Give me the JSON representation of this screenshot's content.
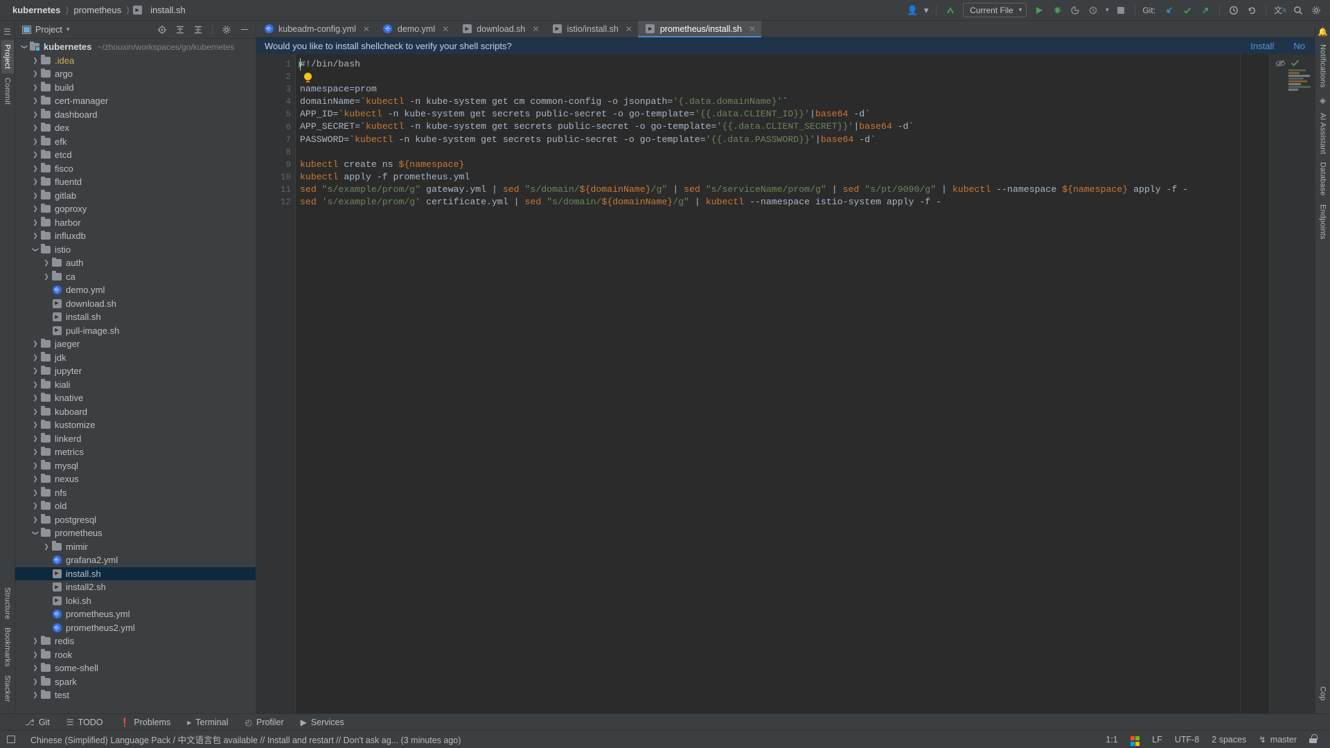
{
  "breadcrumb": {
    "segments": [
      "kubernetes",
      "prometheus",
      "install.sh"
    ],
    "separator": "〉"
  },
  "toolbar_right": {
    "user_icon": "person-icon",
    "updates_icon": "update-arrow-icon",
    "run_config": "Current File",
    "run_icon": "run-icon",
    "debug_icon": "debug-icon",
    "coverage_icon": "coverage-icon",
    "profile_icon": "profile-icon",
    "stop_icon": "stop-icon",
    "git_label": "Git:",
    "git_update_icon": "update-project-icon",
    "git_commit_icon": "commit-icon",
    "git_push_icon": "push-icon",
    "history_icon": "history-icon",
    "rollback_icon": "rollback-icon",
    "translate_icon": "translate-icon",
    "search_icon": "search-icon",
    "settings_icon": "gear-icon",
    "more_icon": "more-vertical-icon"
  },
  "left_rail": {
    "project_label": "Project",
    "commit_label": "Commit",
    "structure_label": "Structure",
    "bookmarks_label": "Bookmarks",
    "stacker_label": "Stacker"
  },
  "right_rail": {
    "notifications_label": "Notifications",
    "ai_assistant_label": "AI Assistant",
    "database_label": "Database",
    "endpoints_label": "Endpoints",
    "cop_label": "Cop"
  },
  "project_panel": {
    "title": "Project",
    "chevron": "▾",
    "icons": [
      "locate-icon",
      "expand-all-icon",
      "collapse-all-icon",
      "gear-icon",
      "minimize-icon"
    ],
    "root": {
      "label": "kubernetes",
      "path": "~/zhouxin/workspaces/go/kubernetes"
    },
    "tree": [
      {
        "label": "kubernetes",
        "type": "root",
        "depth": 0,
        "expanded": true,
        "path": "~/zhouxin/workspaces/go/kubernetes"
      },
      {
        "label": ".idea",
        "type": "folder",
        "depth": 1,
        "expanded": false,
        "color": "yellow"
      },
      {
        "label": "argo",
        "type": "folder",
        "depth": 1,
        "expanded": false
      },
      {
        "label": "build",
        "type": "folder",
        "depth": 1,
        "expanded": false
      },
      {
        "label": "cert-manager",
        "type": "folder",
        "depth": 1,
        "expanded": false
      },
      {
        "label": "dashboard",
        "type": "folder",
        "depth": 1,
        "expanded": false
      },
      {
        "label": "dex",
        "type": "folder",
        "depth": 1,
        "expanded": false
      },
      {
        "label": "efk",
        "type": "folder",
        "depth": 1,
        "expanded": false
      },
      {
        "label": "etcd",
        "type": "folder",
        "depth": 1,
        "expanded": false
      },
      {
        "label": "fisco",
        "type": "folder",
        "depth": 1,
        "expanded": false
      },
      {
        "label": "fluentd",
        "type": "folder",
        "depth": 1,
        "expanded": false
      },
      {
        "label": "gitlab",
        "type": "folder",
        "depth": 1,
        "expanded": false
      },
      {
        "label": "goproxy",
        "type": "folder",
        "depth": 1,
        "expanded": false
      },
      {
        "label": "harbor",
        "type": "folder",
        "depth": 1,
        "expanded": false
      },
      {
        "label": "influxdb",
        "type": "folder",
        "depth": 1,
        "expanded": false
      },
      {
        "label": "istio",
        "type": "folder",
        "depth": 1,
        "expanded": true
      },
      {
        "label": "auth",
        "type": "folder",
        "depth": 2,
        "expanded": false
      },
      {
        "label": "ca",
        "type": "folder",
        "depth": 2,
        "expanded": false
      },
      {
        "label": "demo.yml",
        "type": "yml",
        "depth": 2
      },
      {
        "label": "download.sh",
        "type": "sh",
        "depth": 2
      },
      {
        "label": "install.sh",
        "type": "sh",
        "depth": 2
      },
      {
        "label": "pull-image.sh",
        "type": "sh",
        "depth": 2
      },
      {
        "label": "jaeger",
        "type": "folder",
        "depth": 1,
        "expanded": false
      },
      {
        "label": "jdk",
        "type": "folder",
        "depth": 1,
        "expanded": false
      },
      {
        "label": "jupyter",
        "type": "folder",
        "depth": 1,
        "expanded": false
      },
      {
        "label": "kiali",
        "type": "folder",
        "depth": 1,
        "expanded": false
      },
      {
        "label": "knative",
        "type": "folder",
        "depth": 1,
        "expanded": false
      },
      {
        "label": "kuboard",
        "type": "folder",
        "depth": 1,
        "expanded": false
      },
      {
        "label": "kustomize",
        "type": "folder",
        "depth": 1,
        "expanded": false
      },
      {
        "label": "linkerd",
        "type": "folder",
        "depth": 1,
        "expanded": false
      },
      {
        "label": "metrics",
        "type": "folder",
        "depth": 1,
        "expanded": false
      },
      {
        "label": "mysql",
        "type": "folder",
        "depth": 1,
        "expanded": false
      },
      {
        "label": "nexus",
        "type": "folder",
        "depth": 1,
        "expanded": false
      },
      {
        "label": "nfs",
        "type": "folder",
        "depth": 1,
        "expanded": false
      },
      {
        "label": "old",
        "type": "folder",
        "depth": 1,
        "expanded": false
      },
      {
        "label": "postgresql",
        "type": "folder",
        "depth": 1,
        "expanded": false
      },
      {
        "label": "prometheus",
        "type": "folder",
        "depth": 1,
        "expanded": true
      },
      {
        "label": "mimir",
        "type": "folder",
        "depth": 2,
        "expanded": false
      },
      {
        "label": "grafana2.yml",
        "type": "yml",
        "depth": 2
      },
      {
        "label": "install.sh",
        "type": "sh",
        "depth": 2,
        "selected": true
      },
      {
        "label": "install2.sh",
        "type": "sh",
        "depth": 2
      },
      {
        "label": "loki.sh",
        "type": "sh",
        "depth": 2
      },
      {
        "label": "prometheus.yml",
        "type": "yml",
        "depth": 2
      },
      {
        "label": "prometheus2.yml",
        "type": "yml",
        "depth": 2
      },
      {
        "label": "redis",
        "type": "folder",
        "depth": 1,
        "expanded": false
      },
      {
        "label": "rook",
        "type": "folder",
        "depth": 1,
        "expanded": false
      },
      {
        "label": "some-shell",
        "type": "folder",
        "depth": 1,
        "expanded": false
      },
      {
        "label": "spark",
        "type": "folder",
        "depth": 1,
        "expanded": false
      },
      {
        "label": "test",
        "type": "folder",
        "depth": 1,
        "expanded": false
      }
    ]
  },
  "editor_tabs": [
    {
      "label": "kubeadm-config.yml",
      "icon": "k8s-yml-icon",
      "active": false,
      "closable": true
    },
    {
      "label": "demo.yml",
      "icon": "k8s-yml-icon",
      "active": false,
      "closable": true
    },
    {
      "label": "download.sh",
      "icon": "shell-script-icon",
      "active": false,
      "closable": true
    },
    {
      "label": "istio/install.sh",
      "icon": "shell-script-icon",
      "active": false,
      "closable": true
    },
    {
      "label": "prometheus/install.sh",
      "icon": "shell-script-icon",
      "active": true,
      "closable": true
    }
  ],
  "banner": {
    "message": "Would you like to install shellcheck to verify your shell scripts?",
    "install_label": "Install",
    "dismiss_label": "No"
  },
  "editor": {
    "line_numbers": [
      "1",
      "2",
      "3",
      "4",
      "5",
      "6",
      "7",
      "8",
      "9",
      "10",
      "11",
      "12"
    ],
    "lines": [
      [
        {
          "t": "#!/bin/bash",
          "c": "plain"
        }
      ],
      [
        {
          "t": "",
          "c": "plain"
        }
      ],
      [
        {
          "t": "namespace=prom",
          "c": "plain"
        }
      ],
      [
        {
          "t": "domainName=`",
          "c": "plain"
        },
        {
          "t": "kubectl",
          "c": "cmd"
        },
        {
          "t": " -n kube-system get cm common-config -o jsonpath=",
          "c": "plain"
        },
        {
          "t": "'{.data.domainName}'",
          "c": "str"
        },
        {
          "t": "`",
          "c": "plain"
        }
      ],
      [
        {
          "t": "APP_ID=`",
          "c": "plain"
        },
        {
          "t": "kubectl",
          "c": "cmd"
        },
        {
          "t": " -n kube-system get secrets public-secret -o go-template=",
          "c": "plain"
        },
        {
          "t": "'{{.data.CLIENT_ID}}'",
          "c": "str"
        },
        {
          "t": "|",
          "c": "plain"
        },
        {
          "t": "base64",
          "c": "cmd"
        },
        {
          "t": " -d`",
          "c": "plain"
        }
      ],
      [
        {
          "t": "APP_SECRET=`",
          "c": "plain"
        },
        {
          "t": "kubectl",
          "c": "cmd"
        },
        {
          "t": " -n kube-system get secrets public-secret -o go-template=",
          "c": "plain"
        },
        {
          "t": "'{{.data.CLIENT_SECRET}}'",
          "c": "str"
        },
        {
          "t": "|",
          "c": "plain"
        },
        {
          "t": "base64",
          "c": "cmd"
        },
        {
          "t": " -d`",
          "c": "plain"
        }
      ],
      [
        {
          "t": "PASSWORD=`",
          "c": "plain"
        },
        {
          "t": "kubectl",
          "c": "cmd"
        },
        {
          "t": " -n kube-system get secrets public-secret -o go-template=",
          "c": "plain"
        },
        {
          "t": "'{{.data.PASSWORD}}'",
          "c": "str"
        },
        {
          "t": "|",
          "c": "plain"
        },
        {
          "t": "base64",
          "c": "cmd"
        },
        {
          "t": " -d`",
          "c": "plain"
        }
      ],
      [
        {
          "t": "",
          "c": "plain"
        }
      ],
      [
        {
          "t": "kubectl",
          "c": "cmd"
        },
        {
          "t": " create ns ",
          "c": "plain"
        },
        {
          "t": "${namespace}",
          "c": "var"
        }
      ],
      [
        {
          "t": "kubectl",
          "c": "cmd"
        },
        {
          "t": " apply -f prometheus.yml",
          "c": "plain"
        }
      ],
      [
        {
          "t": "sed",
          "c": "cmd"
        },
        {
          "t": " ",
          "c": "plain"
        },
        {
          "t": "\"s/example/prom/g\"",
          "c": "str"
        },
        {
          "t": " gateway.yml | ",
          "c": "plain"
        },
        {
          "t": "sed",
          "c": "cmd"
        },
        {
          "t": " ",
          "c": "plain"
        },
        {
          "t": "\"s/domain/",
          "c": "str"
        },
        {
          "t": "${domainName}",
          "c": "var"
        },
        {
          "t": "/g\"",
          "c": "str"
        },
        {
          "t": " | ",
          "c": "plain"
        },
        {
          "t": "sed",
          "c": "cmd"
        },
        {
          "t": " ",
          "c": "plain"
        },
        {
          "t": "\"s/serviceName/prom/g\"",
          "c": "str"
        },
        {
          "t": " | ",
          "c": "plain"
        },
        {
          "t": "sed",
          "c": "cmd"
        },
        {
          "t": " ",
          "c": "plain"
        },
        {
          "t": "\"s/pt/9090/g\"",
          "c": "str"
        },
        {
          "t": " | ",
          "c": "plain"
        },
        {
          "t": "kubectl",
          "c": "cmd"
        },
        {
          "t": " --namespace ",
          "c": "plain"
        },
        {
          "t": "${namespace}",
          "c": "var"
        },
        {
          "t": " apply -f -",
          "c": "plain"
        }
      ],
      [
        {
          "t": "sed",
          "c": "cmd"
        },
        {
          "t": " ",
          "c": "plain"
        },
        {
          "t": "'s/example/prom/g'",
          "c": "str"
        },
        {
          "t": " certificate.yml | ",
          "c": "plain"
        },
        {
          "t": "sed",
          "c": "cmd"
        },
        {
          "t": " ",
          "c": "plain"
        },
        {
          "t": "\"s/domain/",
          "c": "str"
        },
        {
          "t": "${domainName}",
          "c": "var"
        },
        {
          "t": "/g\"",
          "c": "str"
        },
        {
          "t": " | ",
          "c": "plain"
        },
        {
          "t": "kubectl",
          "c": "cmd"
        },
        {
          "t": " --namespace istio-system apply -f -",
          "c": "plain"
        }
      ]
    ],
    "bulb_line": 2,
    "run_marker_line": 1
  },
  "bottom_tools": [
    {
      "label": "Git",
      "icon": "git-branch-icon"
    },
    {
      "label": "TODO",
      "icon": "todo-list-icon"
    },
    {
      "label": "Problems",
      "icon": "problems-icon"
    },
    {
      "label": "Terminal",
      "icon": "terminal-icon"
    },
    {
      "label": "Profiler",
      "icon": "profiler-icon"
    },
    {
      "label": "Services",
      "icon": "services-icon"
    }
  ],
  "status_bar": {
    "message": "Chinese (Simplified) Language Pack / 中文语言包 available // Install and restart // Don't ask ag... (3 minutes ago)",
    "caret_position": "1:1",
    "os_icon": "windows-logo-icon",
    "line_separator": "LF",
    "encoding": "UTF-8",
    "indent": "2 spaces",
    "branch": "master",
    "lock_icon": "unlocked-icon"
  },
  "colors": {
    "accent_blue": "#4a88c7",
    "banner_bg": "#1f3449",
    "link_blue": "#5894d3",
    "editor_bg": "#2b2b2b",
    "panel_bg": "#3c3f41",
    "selection": "#0d293e",
    "string_green": "#6a8759",
    "command_orange": "#cc7832",
    "k8s_blue": "#326ce5"
  }
}
